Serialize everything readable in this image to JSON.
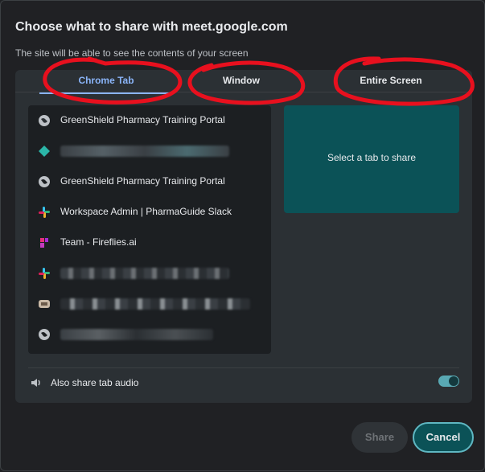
{
  "dialog": {
    "title": "Choose what to share with meet.google.com",
    "subtitle": "The site will be able to see the contents of your screen"
  },
  "tabs": [
    {
      "label": "Chrome Tab",
      "active": true
    },
    {
      "label": "Window",
      "active": false
    },
    {
      "label": "Entire Screen",
      "active": false
    }
  ],
  "list": {
    "items": [
      {
        "icon": "globe-icon",
        "label": "GreenShield Pharmacy Training Portal"
      },
      {
        "icon": "diamond-icon",
        "label": ""
      },
      {
        "icon": "globe-icon",
        "label": "GreenShield Pharmacy Training Portal"
      },
      {
        "icon": "slack-icon",
        "label": "Workspace Admin | PharmaGuide Slack"
      },
      {
        "icon": "fireflies-icon",
        "label": "Team - Fireflies.ai"
      },
      {
        "icon": "slack-icon",
        "label": ""
      },
      {
        "icon": "app-icon",
        "label": ""
      },
      {
        "icon": "globe-icon",
        "label": ""
      }
    ]
  },
  "preview": {
    "text": "Select a tab to share"
  },
  "audio": {
    "label": "Also share tab audio",
    "enabled": true
  },
  "buttons": {
    "share": "Share",
    "cancel": "Cancel"
  },
  "colors": {
    "accent": "#8ab4f8",
    "teal": "#0b5257",
    "annotation": "#e8101e"
  }
}
